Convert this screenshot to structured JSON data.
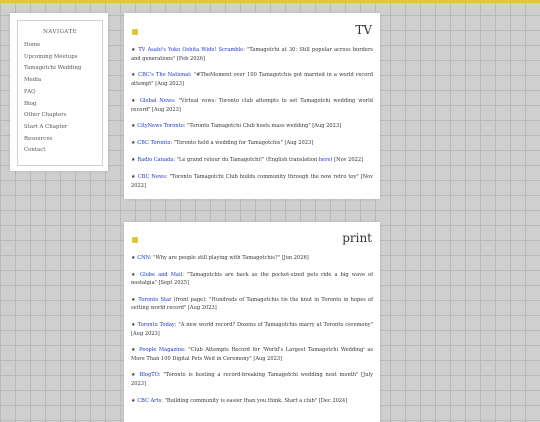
{
  "sidebar": {
    "title": "NAVIGATE",
    "items": [
      {
        "label": "Home"
      },
      {
        "label": "Upcoming Meetups"
      },
      {
        "label": "Tamagotchi Wedding"
      },
      {
        "label": "Media"
      },
      {
        "label": "FAQ"
      },
      {
        "label": "Blog"
      },
      {
        "label": "Other Chapters"
      },
      {
        "label": "Start A Chapter"
      },
      {
        "label": "Resources"
      },
      {
        "label": "Contact"
      }
    ]
  },
  "tv": {
    "title": "TV",
    "entries": [
      {
        "bullet": "★",
        "source": "TV Asahi's Yoko Oshita Wide! Scramble",
        "text": ": \"Tamagotchi at 30: Still popular across borders and generations\" [Feb 2026]"
      },
      {
        "bullet": "★",
        "source": "CBC's The National",
        "text": ": \"#TheMoment over 100 Tamagotchis got married in a world record attempt\" [Aug 2023]"
      },
      {
        "bullet": "★",
        "source": "Global News",
        "text": ": \"Virtual vows: Toronto club attempts to set Tamagotchi wedding world record\" [Aug 2023]"
      },
      {
        "bullet": "★",
        "source": "CityNews Toronto",
        "text": ": \"Toronto Tamagotchi Club hosts mass wedding\" [Aug 2023]"
      },
      {
        "bullet": "★",
        "source": "CBC Toronto",
        "text": ": \"Toronto held a wedding for Tamagotchis\" [Aug 2023]"
      },
      {
        "bullet": "★",
        "source": "Radio Canada",
        "text_before": ": \"Le grand retour du Tamagotchi!\" (English translation ",
        "inline_link": "here",
        "text_after": ") [Nov 2022]"
      },
      {
        "bullet": "★",
        "source": "CBC News",
        "text": ": \"Toronto Tamagotchi Club builds community through the now retro toy\" [Nov 2022]"
      }
    ]
  },
  "print": {
    "title": "print",
    "entries": [
      {
        "bullet": "★",
        "source": "CNN",
        "text": ": \"Why are people still playing with Tamagotchis?\" [Jun 2026]"
      },
      {
        "bullet": "★",
        "source": "Globe and Mail",
        "text": ": \"Tamagotchis are back as the pocket-sized pets ride a big wave of nostalgia\" [Sept 2025]"
      },
      {
        "bullet": "★",
        "source": "Toronto Star",
        "text": " (front page): \"Hundreds of Tamagotchis tie the knot in Toronto in hopes of setting world record\" [Aug 2023]"
      },
      {
        "bullet": "★",
        "source": "Toronto Today",
        "text": ": \"A new world record? Dozens of Tamagotchis marry at Toronto ceremony\" [Aug 2023]"
      },
      {
        "bullet": "★",
        "source": "People Magazine",
        "text": ": \"Club Attempts Record for 'World's Largest Tamagotchi Wedding' as More Than 100 Digital Pets Wed in Ceremony\" [Aug 2023]"
      },
      {
        "bullet": "★",
        "source": "BlogTO",
        "text": ": \"Toronto is hosting a record-breaking Tamagotchi wedding next month\" [July 2023]"
      },
      {
        "bullet": "★",
        "source": "CBC Arts",
        "text": ": \"Building community is easier than you think. Start a club\" [Dec 2024]"
      }
    ]
  }
}
